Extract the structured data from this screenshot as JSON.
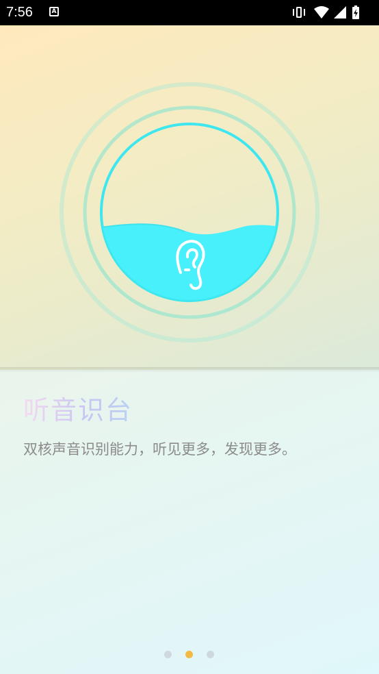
{
  "status_bar": {
    "time": "7:56",
    "notification_icon": "font-a-icon",
    "icons": [
      "vibrate-icon",
      "wifi-icon",
      "signal-icon",
      "battery-charging-icon"
    ]
  },
  "hero": {
    "icon": "ear-icon",
    "accent_color": "#48f0fb",
    "ring_color": "#9fe9d8"
  },
  "content": {
    "title": "听音识台",
    "subtitle": "双核声音识别能力，听见更多，发现更多。"
  },
  "pager": {
    "count": 3,
    "active_index": 1,
    "active_color": "#f4b942",
    "inactive_color": "#cfd8dc"
  }
}
